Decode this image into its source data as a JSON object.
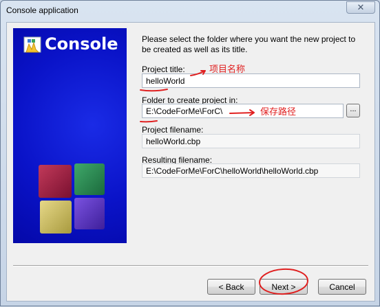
{
  "window": {
    "title": "Console application",
    "close_glyph": "✕"
  },
  "banner": {
    "title": "Console"
  },
  "intro_text": "Please select the folder where you want the new project to be created as well as its title.",
  "fields": {
    "project_title": {
      "label": "Project title:",
      "value": "helloWorld"
    },
    "folder": {
      "label": "Folder to create project in:",
      "value": "E:\\CodeForMe\\ForC\\",
      "browse_label": "..."
    },
    "project_filename": {
      "label": "Project filename:",
      "value": "helloWorld.cbp"
    },
    "resulting_filename": {
      "label": "Resulting filename:",
      "value": "E:\\CodeForMe\\ForC\\helloWorld\\helloWorld.cbp"
    }
  },
  "buttons": {
    "back": "< Back",
    "next": "Next >",
    "cancel": "Cancel"
  },
  "annotations": {
    "title_note": "项目名称",
    "path_note": "保存路径",
    "color": "#e02020"
  },
  "icons": {
    "close": "close-icon",
    "logo": "codeblocks-logo-icon",
    "cubes": "cubes-graphic"
  }
}
